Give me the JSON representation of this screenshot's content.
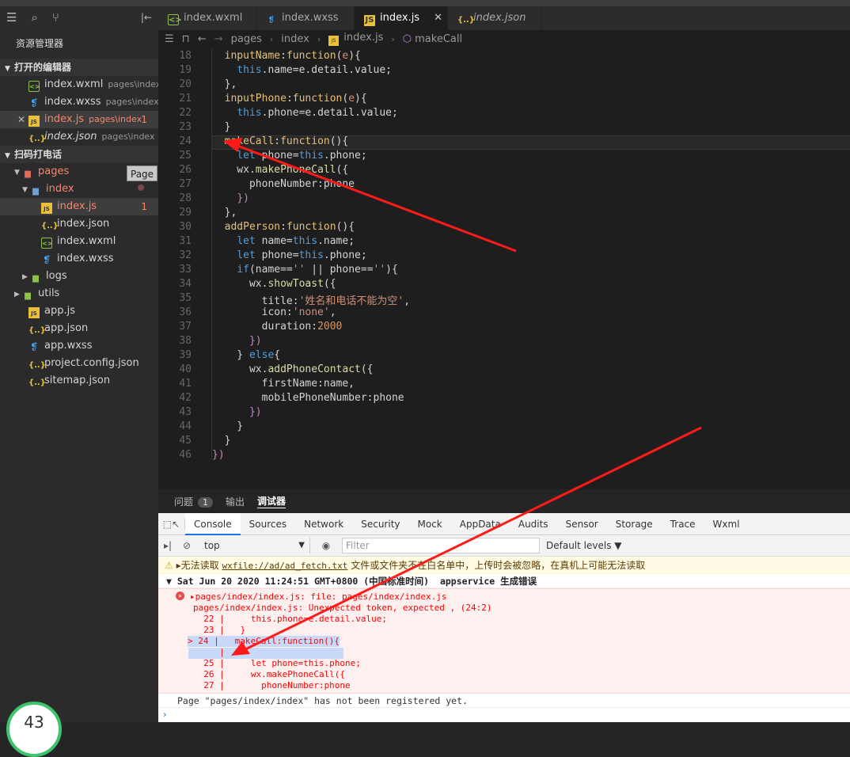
{
  "sidebar": {
    "title": "资源管理器",
    "open_editors_label": "打开的编辑器",
    "open_editors": [
      {
        "name": "index.wxml",
        "path": "pages\\index",
        "icon": "wxml-file-icon",
        "selected": false,
        "error": false
      },
      {
        "name": "index.wxss",
        "path": "pages\\index",
        "icon": "wxss-file-icon",
        "selected": false,
        "error": false
      },
      {
        "name": "index.js",
        "path": "pages\\index",
        "icon": "js-file-icon",
        "selected": true,
        "error": true,
        "badge": "1"
      },
      {
        "name": "index.json",
        "path": "pages\\index",
        "icon": "json-file-icon",
        "selected": false,
        "error": false
      }
    ],
    "project_label": "扫码打电话",
    "tree": {
      "pages": "pages",
      "page_tooltip": "Page",
      "index_folder": "index",
      "index_js": "index.js",
      "index_js_badge": "1",
      "index_json": "index.json",
      "index_wxml": "index.wxml",
      "index_wxss": "index.wxss",
      "logs": "logs",
      "utils": "utils",
      "app_js": "app.js",
      "app_json": "app.json",
      "app_wxss": "app.wxss",
      "project_config": "project.config.json",
      "sitemap": "sitemap.json"
    }
  },
  "tabs": [
    {
      "label": "index.wxml",
      "icon": "wxml-file-icon"
    },
    {
      "label": "index.wxss",
      "icon": "wxss-file-icon"
    },
    {
      "label": "index.js",
      "icon": "js-file-icon",
      "active": true,
      "close": "✕"
    },
    {
      "label": "index.json",
      "icon": "json-file-icon",
      "italic": true
    }
  ],
  "breadcrumb": {
    "a": "pages",
    "b": "index",
    "c": "index.js",
    "d": "makeCall"
  },
  "editor": {
    "line_numbers": [
      "18",
      "19",
      "20",
      "21",
      "22",
      "23",
      "24",
      "25",
      "26",
      "27",
      "28",
      "29",
      "30",
      "31",
      "32",
      "33",
      "34",
      "35",
      "36",
      "37",
      "38",
      "39",
      "40",
      "41",
      "42",
      "43",
      "44",
      "45",
      "46"
    ],
    "toast_title": "姓名和电话不能为空"
  },
  "panel": {
    "problems": "问题",
    "problems_count": "1",
    "output": "输出",
    "debugger": "调试器"
  },
  "devtools": {
    "tabs": [
      "Console",
      "Sources",
      "Network",
      "Security",
      "Mock",
      "AppData",
      "Audits",
      "Sensor",
      "Storage",
      "Trace",
      "Wxml"
    ],
    "context": "top",
    "filter_placeholder": "Filter",
    "levels": "Default levels ▼",
    "warning_prefix": "无法读取",
    "warning_link": "wxfile://ad/ad_fetch.txt",
    "warning_suffix": "文件或文件夹不在白名单中，上传时会被忽略，在真机上可能无法读取",
    "group_header": "Sat Jun 20 2020 11:24:51 GMT+0800 (中国标准时间)  appservice 生成错误",
    "error_lines": [
      "pages/index/index.js: file: pages/index/index.js",
      "pages/index/index.js: Unexpected token, expected , (24:2)",
      "  22 |     this.phone=e.detail.value;",
      "  23 |   }",
      "> 24 |   makeCall:function(){",
      "     |   ^",
      "  25 |     let phone=this.phone;",
      "  26 |     wx.makePhoneCall({",
      "  27 |       phoneNumber:phone"
    ],
    "not_registered": "Page \"pages/index/index\" has not been registered yet.",
    "prompt": "›"
  },
  "timer": "43",
  "colors": {
    "error": "#ff0000",
    "annotation_arrow": "#ff1a1a",
    "accent": "#1a73e8"
  }
}
